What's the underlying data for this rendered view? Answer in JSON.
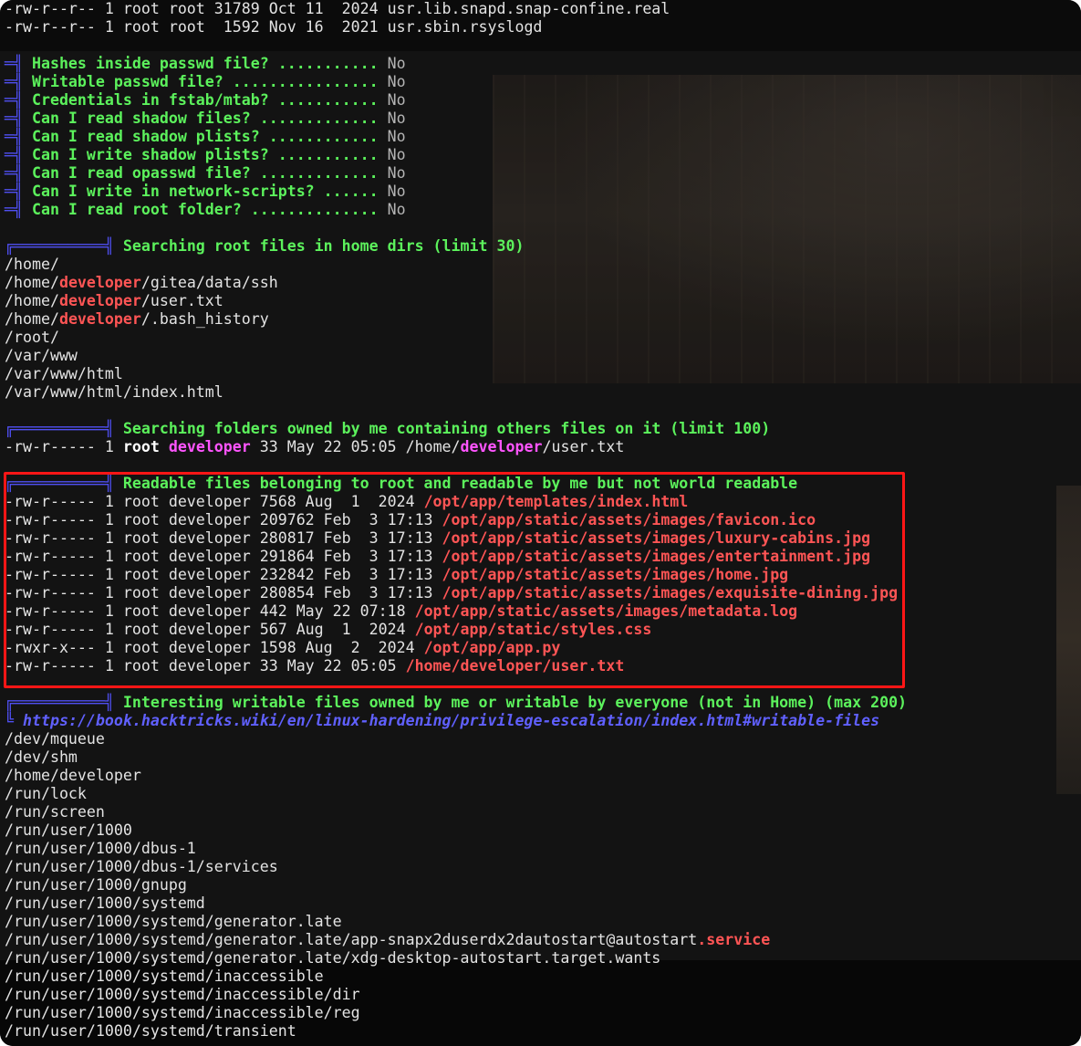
{
  "terminal": {
    "lines": [
      {
        "segments": [
          {
            "text": "-rw-r--r-- 1 root root 31789 Oct 11  2024 usr.lib.snapd.snap-confine.real",
            "color": "#e3e3e3"
          }
        ]
      },
      {
        "segments": [
          {
            "text": "-rw-r--r-- 1 root root  1592 Nov 16  2021 usr.sbin.rsyslogd",
            "color": "#e3e3e3"
          }
        ]
      },
      {
        "segments": []
      },
      {
        "segments": [
          {
            "text": "═╣",
            "color": "#4f4ff2"
          },
          {
            "text": " Hashes inside passwd file? ...........",
            "color": "#5cf25c"
          },
          {
            "text": " No",
            "color": "#b4b4b4"
          }
        ]
      },
      {
        "segments": [
          {
            "text": "═╣",
            "color": "#4f4ff2"
          },
          {
            "text": " Writable passwd file? ................",
            "color": "#5cf25c"
          },
          {
            "text": " No",
            "color": "#b4b4b4"
          }
        ]
      },
      {
        "segments": [
          {
            "text": "═╣",
            "color": "#4f4ff2"
          },
          {
            "text": " Credentials in fstab/mtab? ...........",
            "color": "#5cf25c"
          },
          {
            "text": " No",
            "color": "#b4b4b4"
          }
        ]
      },
      {
        "segments": [
          {
            "text": "═╣",
            "color": "#4f4ff2"
          },
          {
            "text": " Can I read shadow files? .............",
            "color": "#5cf25c"
          },
          {
            "text": " No",
            "color": "#b4b4b4"
          }
        ]
      },
      {
        "segments": [
          {
            "text": "═╣",
            "color": "#4f4ff2"
          },
          {
            "text": " Can I read shadow plists? ............",
            "color": "#5cf25c"
          },
          {
            "text": " No",
            "color": "#b4b4b4"
          }
        ]
      },
      {
        "segments": [
          {
            "text": "═╣",
            "color": "#4f4ff2"
          },
          {
            "text": " Can I write shadow plists? ...........",
            "color": "#5cf25c"
          },
          {
            "text": " No",
            "color": "#b4b4b4"
          }
        ]
      },
      {
        "segments": [
          {
            "text": "═╣",
            "color": "#4f4ff2"
          },
          {
            "text": " Can I read opasswd file? .............",
            "color": "#5cf25c"
          },
          {
            "text": " No",
            "color": "#b4b4b4"
          }
        ]
      },
      {
        "segments": [
          {
            "text": "═╣",
            "color": "#4f4ff2"
          },
          {
            "text": " Can I write in network-scripts? ......",
            "color": "#5cf25c"
          },
          {
            "text": " No",
            "color": "#b4b4b4"
          }
        ]
      },
      {
        "segments": [
          {
            "text": "═╣",
            "color": "#4f4ff2"
          },
          {
            "text": " Can I read root folder? ..............",
            "color": "#5cf25c"
          },
          {
            "text": " No",
            "color": "#b4b4b4"
          }
        ]
      },
      {
        "segments": []
      },
      {
        "segments": [
          {
            "text": "╔══════════╣",
            "color": "#4f4ff2"
          },
          {
            "text": " Searching root files in home dirs (limit 30)",
            "color": "#5cf25c"
          }
        ]
      },
      {
        "segments": [
          {
            "text": "/home/",
            "color": "#e3e3e3"
          }
        ]
      },
      {
        "segments": [
          {
            "text": "/home/",
            "color": "#e3e3e3"
          },
          {
            "text": "developer",
            "color": "#ff5555"
          },
          {
            "text": "/gitea/data/ssh",
            "color": "#e3e3e3"
          }
        ]
      },
      {
        "segments": [
          {
            "text": "/home/",
            "color": "#e3e3e3"
          },
          {
            "text": "developer",
            "color": "#ff5555"
          },
          {
            "text": "/user.txt",
            "color": "#e3e3e3"
          }
        ]
      },
      {
        "segments": [
          {
            "text": "/home/",
            "color": "#e3e3e3"
          },
          {
            "text": "developer",
            "color": "#ff5555"
          },
          {
            "text": "/.bash_history",
            "color": "#e3e3e3"
          }
        ]
      },
      {
        "segments": [
          {
            "text": "/root/",
            "color": "#e3e3e3"
          }
        ]
      },
      {
        "segments": [
          {
            "text": "/var/www",
            "color": "#e3e3e3"
          }
        ]
      },
      {
        "segments": [
          {
            "text": "/var/www/html",
            "color": "#e3e3e3"
          }
        ]
      },
      {
        "segments": [
          {
            "text": "/var/www/html/index.html",
            "color": "#e3e3e3"
          }
        ]
      },
      {
        "segments": []
      },
      {
        "segments": [
          {
            "text": "╔══════════╣",
            "color": "#4f4ff2"
          },
          {
            "text": " Searching folders owned by me containing others files on it (limit 100)",
            "color": "#5cf25c"
          }
        ]
      },
      {
        "segments": [
          {
            "text": "-rw-r----- 1 ",
            "color": "#e3e3e3"
          },
          {
            "text": "root",
            "color": "#ffffff"
          },
          {
            "text": " ",
            "color": "#e3e3e3"
          },
          {
            "text": "developer",
            "color": "#ff55ff"
          },
          {
            "text": " 33 May 22 05:05 /home/",
            "color": "#e3e3e3"
          },
          {
            "text": "developer",
            "color": "#ff55ff"
          },
          {
            "text": "/user.txt",
            "color": "#e3e3e3"
          }
        ]
      },
      {
        "segments": []
      },
      {
        "segments": [
          {
            "text": "╔══════════╣",
            "color": "#4f4ff2"
          },
          {
            "text": " Readable files belonging to root and readable by me but not world readable",
            "color": "#5cf25c"
          }
        ]
      },
      {
        "segments": [
          {
            "text": "-rw-r----- 1 root developer 7568 Aug  1  2024 ",
            "color": "#e3e3e3"
          },
          {
            "text": "/opt/app/templates/index.html",
            "color": "#ff5555"
          }
        ]
      },
      {
        "segments": [
          {
            "text": "-rw-r----- 1 root developer 209762 Feb  3 17:13 ",
            "color": "#e3e3e3"
          },
          {
            "text": "/opt/app/static/assets/images/favicon.ico",
            "color": "#ff5555"
          }
        ]
      },
      {
        "segments": [
          {
            "text": "-rw-r----- 1 root developer 280817 Feb  3 17:13 ",
            "color": "#e3e3e3"
          },
          {
            "text": "/opt/app/static/assets/images/luxury-cabins.jpg",
            "color": "#ff5555"
          }
        ]
      },
      {
        "segments": [
          {
            "text": "-rw-r----- 1 root developer 291864 Feb  3 17:13 ",
            "color": "#e3e3e3"
          },
          {
            "text": "/opt/app/static/assets/images/entertainment.jpg",
            "color": "#ff5555"
          }
        ]
      },
      {
        "segments": [
          {
            "text": "-rw-r----- 1 root developer 232842 Feb  3 17:13 ",
            "color": "#e3e3e3"
          },
          {
            "text": "/opt/app/static/assets/images/home.jpg",
            "color": "#ff5555"
          }
        ]
      },
      {
        "segments": [
          {
            "text": "-rw-r----- 1 root developer 280854 Feb  3 17:13 ",
            "color": "#e3e3e3"
          },
          {
            "text": "/opt/app/static/assets/images/exquisite-dining.jpg",
            "color": "#ff5555"
          }
        ]
      },
      {
        "segments": [
          {
            "text": "-rw-r----- 1 root developer 442 May 22 07:18 ",
            "color": "#e3e3e3"
          },
          {
            "text": "/opt/app/static/assets/images/metadata.log",
            "color": "#ff5555"
          }
        ]
      },
      {
        "segments": [
          {
            "text": "-rw-r----- 1 root developer 567 Aug  1  2024 ",
            "color": "#e3e3e3"
          },
          {
            "text": "/opt/app/static/styles.css",
            "color": "#ff5555"
          }
        ]
      },
      {
        "segments": [
          {
            "text": "-rwxr-x--- 1 root developer 1598 Aug  2  2024 ",
            "color": "#e3e3e3"
          },
          {
            "text": "/opt/app/app.py",
            "color": "#ff5555"
          }
        ]
      },
      {
        "segments": [
          {
            "text": "-rw-r----- 1 root developer 33 May 22 05:05 ",
            "color": "#e3e3e3"
          },
          {
            "text": "/home/developer/user.txt",
            "color": "#ff5555"
          }
        ]
      },
      {
        "segments": []
      },
      {
        "segments": [
          {
            "text": "╔══════════╣",
            "color": "#4f4ff2"
          },
          {
            "text": " Interesting writable files owned by me or writable by everyone (not in Home) (max 200)",
            "color": "#5cf25c"
          }
        ]
      },
      {
        "segments": [
          {
            "text": "╚",
            "color": "#4f4ff2"
          },
          {
            "text": " ",
            "color": "#e3e3e3"
          },
          {
            "text": "https://book.hacktricks.wiki/en/linux-hardening/privilege-escalation/index.html#writable-files",
            "color": "#6060ff"
          }
        ]
      },
      {
        "segments": [
          {
            "text": "/dev/mqueue",
            "color": "#e3e3e3"
          }
        ]
      },
      {
        "segments": [
          {
            "text": "/dev/shm",
            "color": "#e3e3e3"
          }
        ]
      },
      {
        "segments": [
          {
            "text": "/home/developer",
            "color": "#e3e3e3"
          }
        ]
      },
      {
        "segments": [
          {
            "text": "/run/lock",
            "color": "#e3e3e3"
          }
        ]
      },
      {
        "segments": [
          {
            "text": "/run/screen",
            "color": "#e3e3e3"
          }
        ]
      },
      {
        "segments": [
          {
            "text": "/run/user/1000",
            "color": "#e3e3e3"
          }
        ]
      },
      {
        "segments": [
          {
            "text": "/run/user/1000/dbus-1",
            "color": "#e3e3e3"
          }
        ]
      },
      {
        "segments": [
          {
            "text": "/run/user/1000/dbus-1/services",
            "color": "#e3e3e3"
          }
        ]
      },
      {
        "segments": [
          {
            "text": "/run/user/1000/gnupg",
            "color": "#e3e3e3"
          }
        ]
      },
      {
        "segments": [
          {
            "text": "/run/user/1000/systemd",
            "color": "#e3e3e3"
          }
        ]
      },
      {
        "segments": [
          {
            "text": "/run/user/1000/systemd/generator.late",
            "color": "#e3e3e3"
          }
        ]
      },
      {
        "segments": [
          {
            "text": "/run/user/1000/systemd/generator.late/app-snapx2duserdx2dautostart@autostart",
            "color": "#e3e3e3"
          },
          {
            "text": ".service",
            "color": "#ff5555"
          }
        ]
      },
      {
        "segments": [
          {
            "text": "/run/user/1000/systemd/generator.late/xdg-desktop-autostart.target.wants",
            "color": "#e3e3e3"
          }
        ]
      },
      {
        "segments": [
          {
            "text": "/run/user/1000/systemd/inaccessible",
            "color": "#e3e3e3"
          }
        ]
      },
      {
        "segments": [
          {
            "text": "/run/user/1000/systemd/inaccessible/dir",
            "color": "#e3e3e3"
          }
        ]
      },
      {
        "segments": [
          {
            "text": "/run/user/1000/systemd/inaccessible/reg",
            "color": "#e3e3e3"
          }
        ]
      },
      {
        "segments": [
          {
            "text": "/run/user/1000/systemd/transient",
            "color": "#e3e3e3"
          }
        ]
      }
    ]
  },
  "highlight_box": {
    "color": "#ff1616"
  }
}
